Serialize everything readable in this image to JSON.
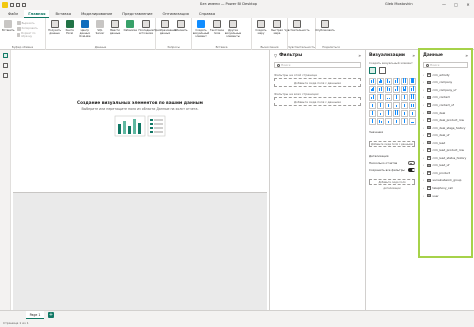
{
  "window": {
    "title": "Без имени — Power BI Desktop",
    "user": "Gleb Mostovkin",
    "controls": [
      "—",
      "□",
      "✕"
    ]
  },
  "menu": {
    "tabs": [
      "Файл",
      "Главная",
      "Вставка",
      "Моделирование",
      "Представление",
      "Оптимизация",
      "Справка"
    ],
    "active": "Главная"
  },
  "ribbon": {
    "clipboard": {
      "group": "Буфер обмена",
      "paste": "Вставить",
      "cut": "Вырезать",
      "copy": "Копировать",
      "format": "Формат по образцу"
    },
    "data": {
      "group": "Данные",
      "get_data": "Получить данные",
      "excel": "Книга Excel",
      "hub": "Центр данных OneLake",
      "sql": "SQL Server",
      "enter": "Ввести данные",
      "dataverse": "Dataverse",
      "recent": "Последние источники"
    },
    "queries": {
      "group": "Запросы",
      "transform": "Преобразование данных",
      "refresh": "Обновить"
    },
    "insert": {
      "group": "Вставка",
      "new_visual": "Создать визуальный элемент",
      "textbox": "Текстовое поле",
      "more_visuals": "Другие визуальные элементы"
    },
    "calc": {
      "group": "Вычисления",
      "new_measure": "Создать меру",
      "quick_measure": "Быстрая мера"
    },
    "sensitivity": {
      "group": "Чувствительность",
      "label": "Чувствительность"
    },
    "share": {
      "group": "Поделиться",
      "publish": "Опубликовать"
    }
  },
  "canvas": {
    "empty_title": "Создание визуальных элементов по вашим данным",
    "empty_subtitle": "Выберите или перетащите поля из области Данные на холст отчета."
  },
  "pages": {
    "tabs": [
      "Page 1"
    ],
    "add": "+"
  },
  "status": {
    "text": "Страница 1 из 1"
  },
  "filters": {
    "title": "Фильтры",
    "search_placeholder": "Поиск",
    "on_page_label": "Фильтры на этой странице",
    "on_page_drop": "Добавьте сюда поля с данными",
    "all_pages_label": "Фильтры на всех страницах",
    "all_pages_drop": "Добавьте сюда поля с данными"
  },
  "visualizations": {
    "title": "Визуализации",
    "subtitle": "Создать визуальный элемент",
    "values_label": "Значения",
    "values_drop": "Добавьте сюда поля с данными",
    "drillthrough_label": "Детализация",
    "cross_report_label": "Несколько отчетов",
    "keep_filters_label": "Сохранить все фильтры",
    "drill_drop": "Добавьте сюда поля детализации"
  },
  "data_pane": {
    "title": "Данные",
    "search_placeholder": "Поиск",
    "tables": [
      "crm_activity",
      "crm_company",
      "crm_company_uf",
      "crm_contact",
      "crm_contact_uf",
      "crm_deal",
      "crm_deal_product_row",
      "crm_deal_stage_history",
      "crm_deal_uf",
      "crm_lead",
      "crm_lead_product_row",
      "crm_lead_status_history",
      "crm_lead_uf",
      "crm_product",
      "socialnetwork_group",
      "telephony_call",
      "user"
    ]
  }
}
